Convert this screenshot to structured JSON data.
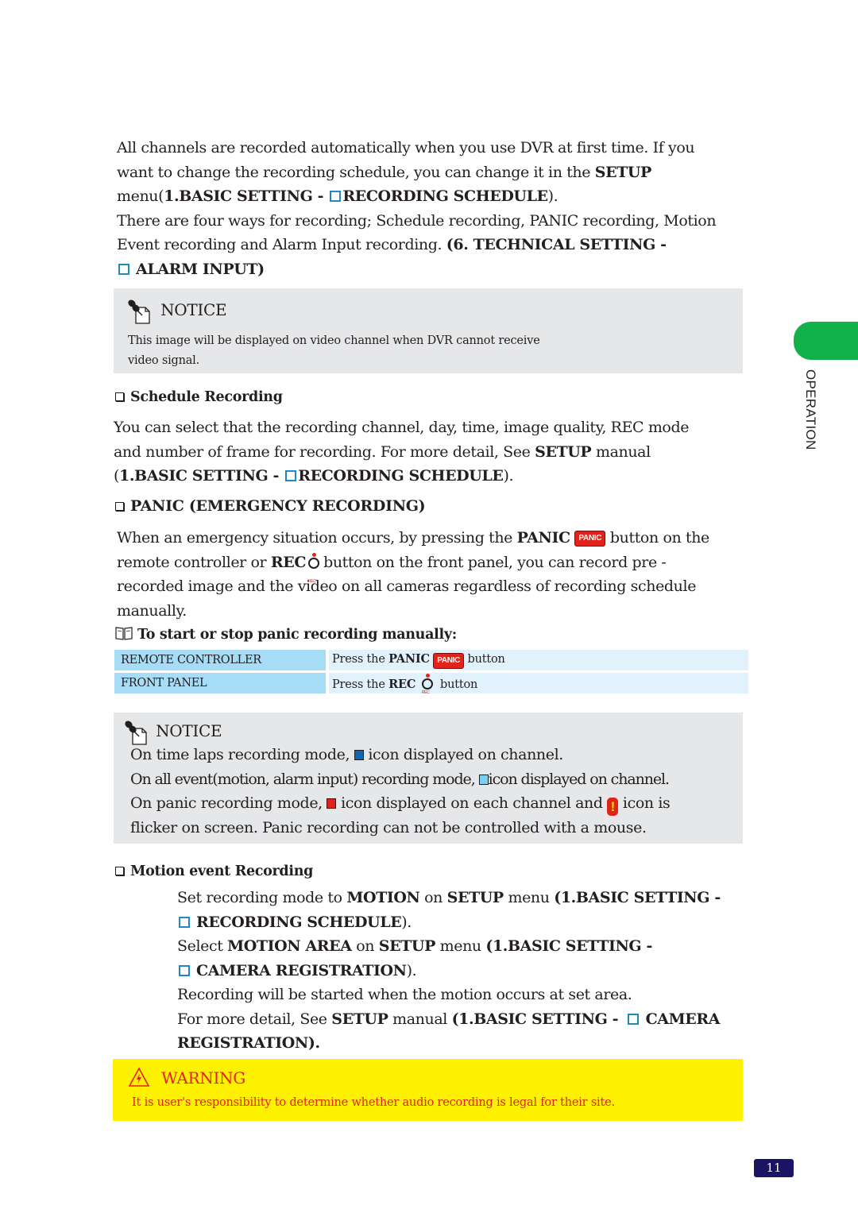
{
  "side_tab": {
    "label": "OPERATION",
    "color": "#12b24b"
  },
  "intro": {
    "line1": "All channels are recorded automatically when you use DVR at first time. If you",
    "line2_pre": "want to change the recording schedule, you can change it in the ",
    "line2_bold": "SETUP",
    "line3_pre": "menu(",
    "line3_bold1": "1.BASIC SETTING - ",
    "line3_bold2": "RECORDING SCHEDULE",
    "line3_post": ").",
    "line4": "There are four ways for recording; Schedule recording, PANIC recording, Motion",
    "line5_pre": "Event recording and Alarm Input recording.  ",
    "line5_bold": "(6. TECHNICAL SETTING -",
    "line6_bold": "ALARM INPUT)"
  },
  "notice1": {
    "title": "NOTICE",
    "line1": "This image will be displayed on video channel when DVR cannot receive",
    "line2": "video signal."
  },
  "schedule": {
    "heading": "Schedule Recording",
    "line1": "You can select that the recording channel, day, time, image quality, REC mode",
    "line2_pre": "and number of frame for recording.  For more detail, See ",
    "line2_bold": "SETUP",
    "line2_post": " manual",
    "line3_pre": "(",
    "line3_bold1": "1.BASIC SETTING - ",
    "line3_bold2": "RECORDING SCHEDULE",
    "line3_post": ")."
  },
  "panic": {
    "heading": "PANIC (EMERGENCY RECORDING)",
    "line1_pre": "When an emergency situation occurs, by pressing the ",
    "line1_bold": "PANIC",
    "line1_post": " button on the",
    "badge": "PANIC",
    "line2_pre": "remote controller or ",
    "line2_bold": "REC",
    "line2_post": "button on the front panel, you can record pre -",
    "rec_label": "REC",
    "line3": "recorded image and the video on all cameras regardless of recording schedule",
    "line4": "manually.",
    "sub_heading": "To start or stop panic recording manually:",
    "table": [
      {
        "label": "REMOTE CONTROLLER",
        "pre": "Press the ",
        "bold": "PANIC",
        "icon": "panic-button-icon",
        "post": " button"
      },
      {
        "label": "FRONT PANEL",
        "pre": "Press the ",
        "bold": "REC",
        "icon": "rec-button-icon",
        "post": " button"
      }
    ]
  },
  "notice2": {
    "title": "NOTICE",
    "line1_pre": "On time laps recording mode, ",
    "line1_post": " icon displayed on channel.",
    "line2_pre": "On all event(motion, alarm input) recording mode, ",
    "line2_post": "icon displayed on channel.",
    "line3_pre": "On panic recording mode, ",
    "line3_mid": " icon displayed on each channel and ",
    "line3_post": " icon is",
    "excl": "!",
    "line4": "flicker on screen. Panic recording can not be controlled with a mouse."
  },
  "motion": {
    "heading": "Motion event Recording",
    "l1_pre": "Set recording mode to ",
    "l1_b1": "MOTION",
    "l1_mid": " on ",
    "l1_b2": "SETUP",
    "l1_mid2": " menu ",
    "l1_b3": "(1.BASIC SETTING -",
    "l2_bold": "RECORDING SCHEDULE",
    "l2_post": ").",
    "l3_pre": "Select ",
    "l3_b1": "MOTION AREA",
    "l3_mid": " on ",
    "l3_b2": "SETUP",
    "l3_mid2": " menu ",
    "l3_b3": "(1.BASIC SETTING -",
    "l4_bold": "CAMERA REGISTRATION",
    "l4_post": ").",
    "l5": "Recording will be started when the motion occurs at set area.",
    "l6_pre": "For more detail, See ",
    "l6_b1": "SETUP",
    "l6_mid": " manual ",
    "l6_b2": "(1.BASIC SETTING - ",
    "l6_b3": " CAMERA",
    "l7_bold": "REGISTRATION)."
  },
  "warning": {
    "title": "WARNING",
    "text": "It is user's responsibility to determine whether audio recording is legal for their site."
  },
  "page_number": "11"
}
